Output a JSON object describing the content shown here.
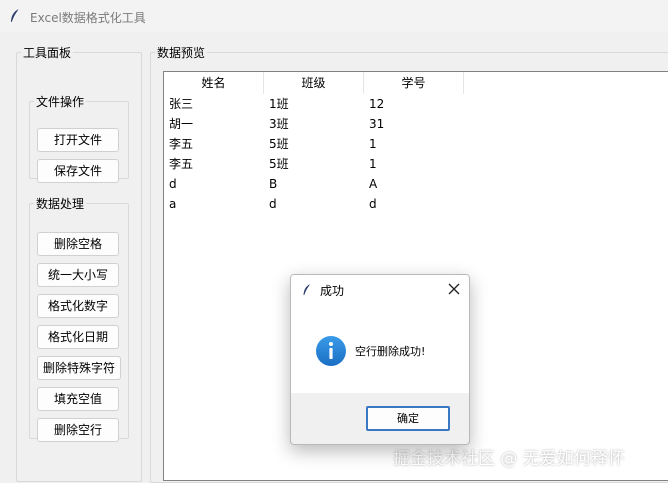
{
  "window": {
    "title": "Excel数据格式化工具"
  },
  "tool_panel": {
    "legend": "工具面板",
    "file_ops": {
      "legend": "文件操作",
      "buttons": [
        "打开文件",
        "保存文件"
      ]
    },
    "data_proc": {
      "legend": "数据处理",
      "buttons": [
        "删除空格",
        "统一大小写",
        "格式化数字",
        "格式化日期",
        "删除特殊字符",
        "填充空值",
        "删除空行"
      ]
    }
  },
  "preview": {
    "legend": "数据预览",
    "columns": [
      "姓名",
      "班级",
      "学号"
    ],
    "rows": [
      [
        "张三",
        "1班",
        "12"
      ],
      [
        "胡一",
        "3班",
        "31"
      ],
      [
        "李五",
        "5班",
        "1"
      ],
      [
        "李五",
        "5班",
        "1"
      ],
      [
        "d",
        "B",
        "A"
      ],
      [
        "a",
        "d",
        "d"
      ]
    ]
  },
  "dialog": {
    "title": "成功",
    "message": "空行删除成功!",
    "ok_label": "确定"
  },
  "watermark": "掘金技术社区 @ 无爱如何释怀",
  "icons": {
    "app": "feather-icon",
    "info": "info-icon",
    "close": "close-icon"
  },
  "colors": {
    "info_blue": "#1c7fd6",
    "focus_border": "#3b78c4"
  }
}
